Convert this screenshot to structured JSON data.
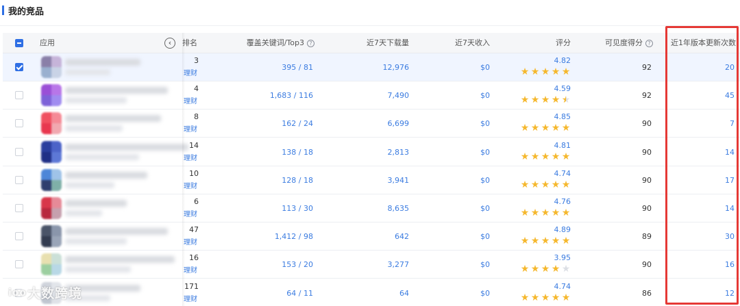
{
  "section": {
    "title": "我的竞品"
  },
  "columns": {
    "app": "应用",
    "rank": "排名",
    "keywords": "覆盖关键词/Top3",
    "downloads": "近7天下载量",
    "revenue": "近7天收入",
    "rating": "评分",
    "visibility": "可见度得分",
    "updates": "近1年版本更新次数"
  },
  "rows": [
    {
      "rank": "3",
      "category": "理财",
      "keywords": "395 / 81",
      "downloads": "12,976",
      "revenue": "$0",
      "rating": "4.82",
      "stars": 5,
      "visibility": "92",
      "updates": "20",
      "selected": true,
      "icon": [
        "#8a7fa8",
        "#c6b4d9",
        "#9ab0cf",
        "#c9d3e6"
      ]
    },
    {
      "rank": "4",
      "category": "理财",
      "keywords": "1,683 / 116",
      "downloads": "7,490",
      "revenue": "$0",
      "rating": "4.59",
      "stars": 4.5,
      "visibility": "92",
      "updates": "45",
      "selected": false,
      "icon": [
        "#9a4fd6",
        "#b876e8",
        "#7d62d8",
        "#a08cf0"
      ]
    },
    {
      "rank": "8",
      "category": "理财",
      "keywords": "162 / 24",
      "downloads": "6,699",
      "revenue": "$0",
      "rating": "4.85",
      "stars": 5,
      "visibility": "90",
      "updates": "7",
      "selected": false,
      "icon": [
        "#f05060",
        "#f58a96",
        "#e8374f",
        "#f1a8b0"
      ]
    },
    {
      "rank": "14",
      "category": "理财",
      "keywords": "138 / 18",
      "downloads": "2,813",
      "revenue": "$0",
      "rating": "4.81",
      "stars": 5,
      "visibility": "90",
      "updates": "14",
      "selected": false,
      "icon": [
        "#2a3e9e",
        "#4c63c8",
        "#1f2f86",
        "#5d78d6"
      ]
    },
    {
      "rank": "10",
      "category": "理财",
      "keywords": "128 / 18",
      "downloads": "3,941",
      "revenue": "$0",
      "rating": "4.74",
      "stars": 5,
      "visibility": "90",
      "updates": "17",
      "selected": false,
      "icon": [
        "#4d86d8",
        "#9fc3e8",
        "#2e3e6e",
        "#7fb0a8"
      ]
    },
    {
      "rank": "6",
      "category": "理财",
      "keywords": "113 / 30",
      "downloads": "8,635",
      "revenue": "$0",
      "rating": "4.76",
      "stars": 5,
      "visibility": "90",
      "updates": "14",
      "selected": false,
      "icon": [
        "#d8364a",
        "#e68a98",
        "#b8283e",
        "#c6a0ae"
      ]
    },
    {
      "rank": "47",
      "category": "理财",
      "keywords": "1,412 / 98",
      "downloads": "642",
      "revenue": "$0",
      "rating": "4.89",
      "stars": 5,
      "visibility": "89",
      "updates": "30",
      "selected": false,
      "icon": [
        "#4a5468",
        "#8a96ab",
        "#333c50",
        "#9aa5b8"
      ]
    },
    {
      "rank": "16",
      "category": "理财",
      "keywords": "153 / 20",
      "downloads": "3,277",
      "revenue": "$0",
      "rating": "3.95",
      "stars": 4,
      "visibility": "90",
      "updates": "16",
      "selected": false,
      "icon": [
        "#e8e0b0",
        "#cbe0d8",
        "#9ccfa0",
        "#b8d8e6"
      ]
    },
    {
      "rank": "171",
      "category": "理财",
      "keywords": "64 / 11",
      "downloads": "64",
      "revenue": "$0",
      "rating": "4.74",
      "stars": 5,
      "visibility": "86",
      "updates": "12",
      "selected": false,
      "icon": [
        "#d0d4dc",
        "#e2e5ea",
        "#c0c6d0",
        "#dfe2e8"
      ]
    }
  ],
  "watermark": {
    "logo": "ioo",
    "text": "大数跨境"
  },
  "colors": {
    "accent": "#2f6fe4",
    "link": "#3a7be0",
    "star": "#f5b82e",
    "highlight": "#e53935"
  }
}
